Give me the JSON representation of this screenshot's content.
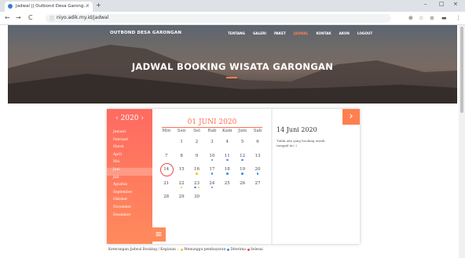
{
  "browser": {
    "tab_title": "Jadwal || Outbond Desa Garong...",
    "tab_close": "×",
    "new_tab": "+",
    "url": "niyo.adik.my.id/jadwal",
    "back": "←",
    "forward": "→",
    "reload": "C",
    "window_min": "–",
    "window_max": "□",
    "window_close": "×"
  },
  "site": {
    "brand": "OUTBOND DESA GARONGAN",
    "menu": [
      "TENTANG",
      "GALERI",
      "PAKET",
      "JADWAL",
      "KONTAK",
      "AKUN",
      "LOGOUT"
    ],
    "active_menu": "JADWAL",
    "hero_title": "JADWAL BOOKING WISATA GARONGAN"
  },
  "calendar": {
    "year": "2020",
    "prev_year": "‹",
    "next_year": "›",
    "months": [
      "Januari",
      "Februari",
      "Maret",
      "April",
      "Mei",
      "Juni",
      "Juli",
      "Agustus",
      "September",
      "Oktober",
      "November",
      "Desember"
    ],
    "active_month": "Juni",
    "title": "01 JUNI 2020",
    "weekdays": [
      "Min",
      "Sen",
      "Sel",
      "Rab",
      "Kam",
      "Jum",
      "Sab"
    ],
    "weeks": [
      [
        "",
        "1",
        "2",
        "3",
        "4",
        "5",
        "6"
      ],
      [
        "7",
        "8",
        "9",
        "10",
        "11",
        "12",
        "13"
      ],
      [
        "14",
        "15",
        "16",
        "17",
        "18",
        "19",
        "20"
      ],
      [
        "21",
        "22",
        "23",
        "24",
        "25",
        "26",
        "27"
      ],
      [
        "28",
        "29",
        "30",
        "",
        "",
        "",
        ""
      ]
    ],
    "today": "14",
    "blue_dot_days": [
      "10",
      "11",
      "12",
      "17",
      "18",
      "19",
      "20",
      "23",
      "24"
    ],
    "yellow_dot_days": [
      "16",
      "22",
      "23"
    ],
    "selected_date": "14 Juni 2020",
    "detail_message": "Tidak ada yang booking untuk tanggal ini :)",
    "next_label": "›",
    "menu_label": "≡"
  },
  "legend": {
    "prefix": "Keterangan Jadwal Booking / Kegiatan :",
    "items": [
      {
        "label": "Menunggu pembayaran",
        "color": "#f5c518"
      },
      {
        "label": "Diterima",
        "color": "#3d8bff"
      },
      {
        "label": "Selesai",
        "color": "#e84a4a"
      }
    ]
  }
}
